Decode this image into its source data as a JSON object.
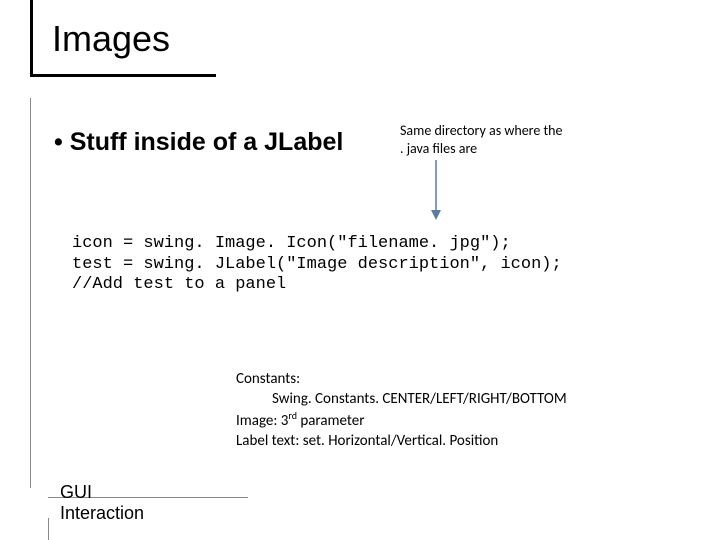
{
  "title": "Images",
  "bullet": "• Stuff inside of a JLabel",
  "note_line1": "Same directory as where the",
  "note_line2": ". java files are",
  "code_line1": "icon = swing. Image. Icon(\"filename. jpg\");",
  "code_line2": "test = swing. JLabel(\"Image description\", icon);",
  "code_line3": "//Add test to a panel",
  "constants_label": "Constants:",
  "constants_values": "Swing. Constants. CENTER/LEFT/RIGHT/BOTTOM",
  "image_param_label": "Image:  3",
  "image_param_sup": "rd",
  "image_param_rest": " parameter",
  "label_text_line": "Label text:  set. Horizontal/Vertical. Position",
  "footer": "GUI Interaction"
}
